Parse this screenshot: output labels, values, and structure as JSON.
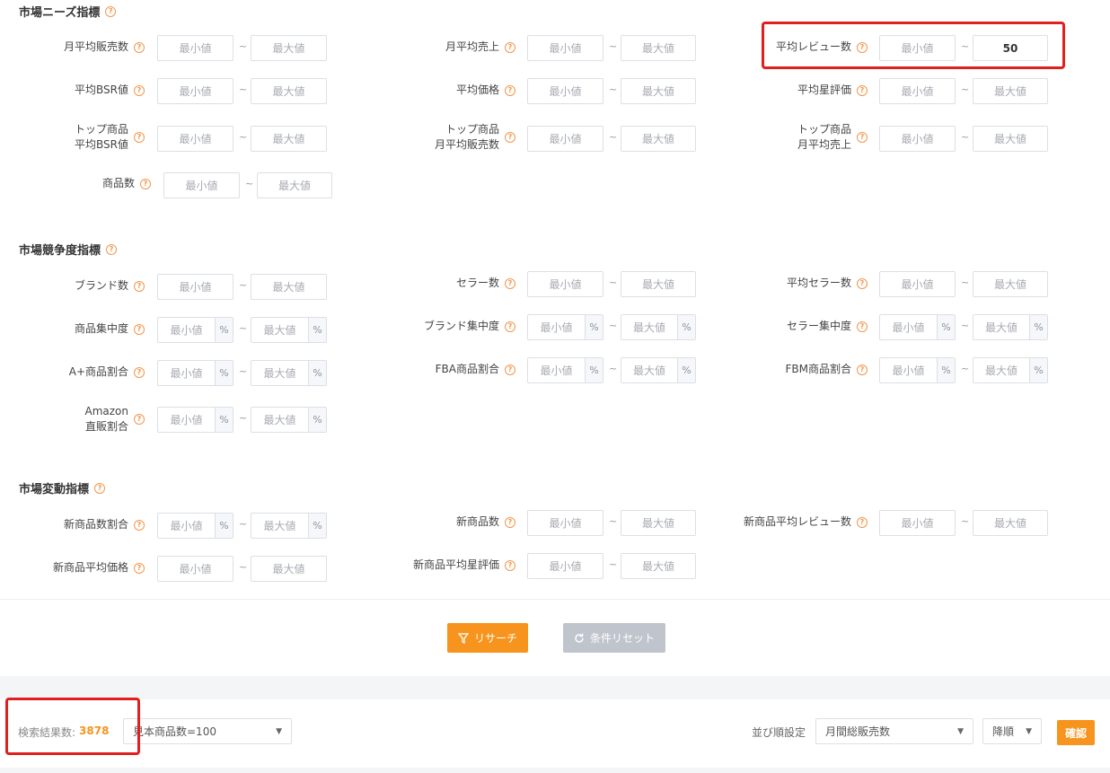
{
  "help_glyph": "?",
  "tilde": "~",
  "placeholders": {
    "min": "最小値",
    "max": "最大値"
  },
  "unit_percent": "%",
  "sections": {
    "needs": {
      "title": "市場ニーズ指標",
      "fields": {
        "monthly_avg_sales_qty": "月平均販売数",
        "monthly_avg_revenue": "月平均売上",
        "avg_review_count": "平均レビュー数",
        "avg_bsr": "平均BSR値",
        "avg_price": "平均価格",
        "avg_star_rating": "平均星評価",
        "top_avg_bsr": "トップ商品\n平均BSR値",
        "top_monthly_sales_qty": "トップ商品\n月平均販売数",
        "top_monthly_revenue": "トップ商品\n月平均売上",
        "product_count": "商品数"
      },
      "avg_review_count_max_value": "50"
    },
    "competition": {
      "title": "市場競争度指標",
      "fields": {
        "brand_count": "ブランド数",
        "seller_count": "セラー数",
        "avg_seller_count": "平均セラー数",
        "product_concentration": "商品集中度",
        "brand_concentration": "ブランド集中度",
        "seller_concentration": "セラー集中度",
        "aplus_ratio": "A+商品割合",
        "fba_ratio": "FBA商品割合",
        "fbm_ratio": "FBM商品割合",
        "amazon_direct_ratio": "Amazon\n直販割合"
      }
    },
    "change": {
      "title": "市場変動指標",
      "fields": {
        "new_product_ratio": "新商品数割合",
        "new_product_count": "新商品数",
        "new_avg_review": "新商品平均レビュー数",
        "new_avg_price": "新商品平均価格",
        "new_avg_star": "新商品平均星評価"
      }
    }
  },
  "buttons": {
    "research": "リサーチ",
    "reset": "条件リセット",
    "confirm": "確認"
  },
  "results": {
    "label": "検索結果数:",
    "count": "3878",
    "sample_select": "見本商品数=100",
    "sort_label": "並び順設定",
    "sort_field": "月間総販売数",
    "sort_order": "降順"
  },
  "colors": {
    "accent": "#f7941d",
    "highlight": "#e0201e"
  }
}
